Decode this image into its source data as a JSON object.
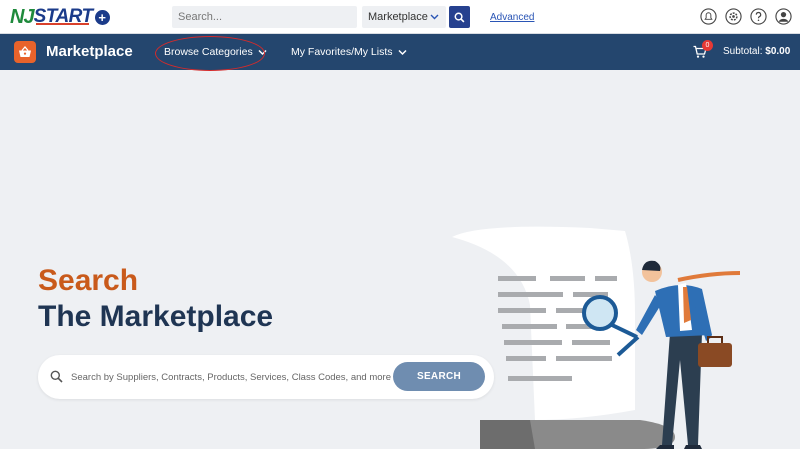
{
  "logo": {
    "nj": "NJ",
    "start": "START",
    "plus": "+"
  },
  "top_search": {
    "placeholder": "Search...",
    "scope_value": "Marketplace",
    "advanced_link": "Advanced"
  },
  "top_icons": [
    "notifications-icon",
    "settings-icon",
    "help-icon",
    "user-icon"
  ],
  "nav": {
    "title": "Marketplace",
    "items": [
      {
        "label": "Browse Categories"
      },
      {
        "label": "My Favorites/My Lists"
      }
    ],
    "cart_count": "0",
    "subtotal_label": "Subtotal:",
    "subtotal_value": "$0.00"
  },
  "hero": {
    "line1": "Search",
    "line2": "The Marketplace",
    "search_placeholder": "Search by Suppliers, Contracts, Products, Services, Class Codes, and more",
    "search_button": "SEARCH"
  },
  "colors": {
    "nav_bg": "#24466e",
    "accent_orange": "#c95a1b",
    "title_navy": "#1f3553",
    "search_button": "#6f8db0",
    "top_search_button": "#26418f",
    "highlight_ellipse": "#d42b2b"
  }
}
